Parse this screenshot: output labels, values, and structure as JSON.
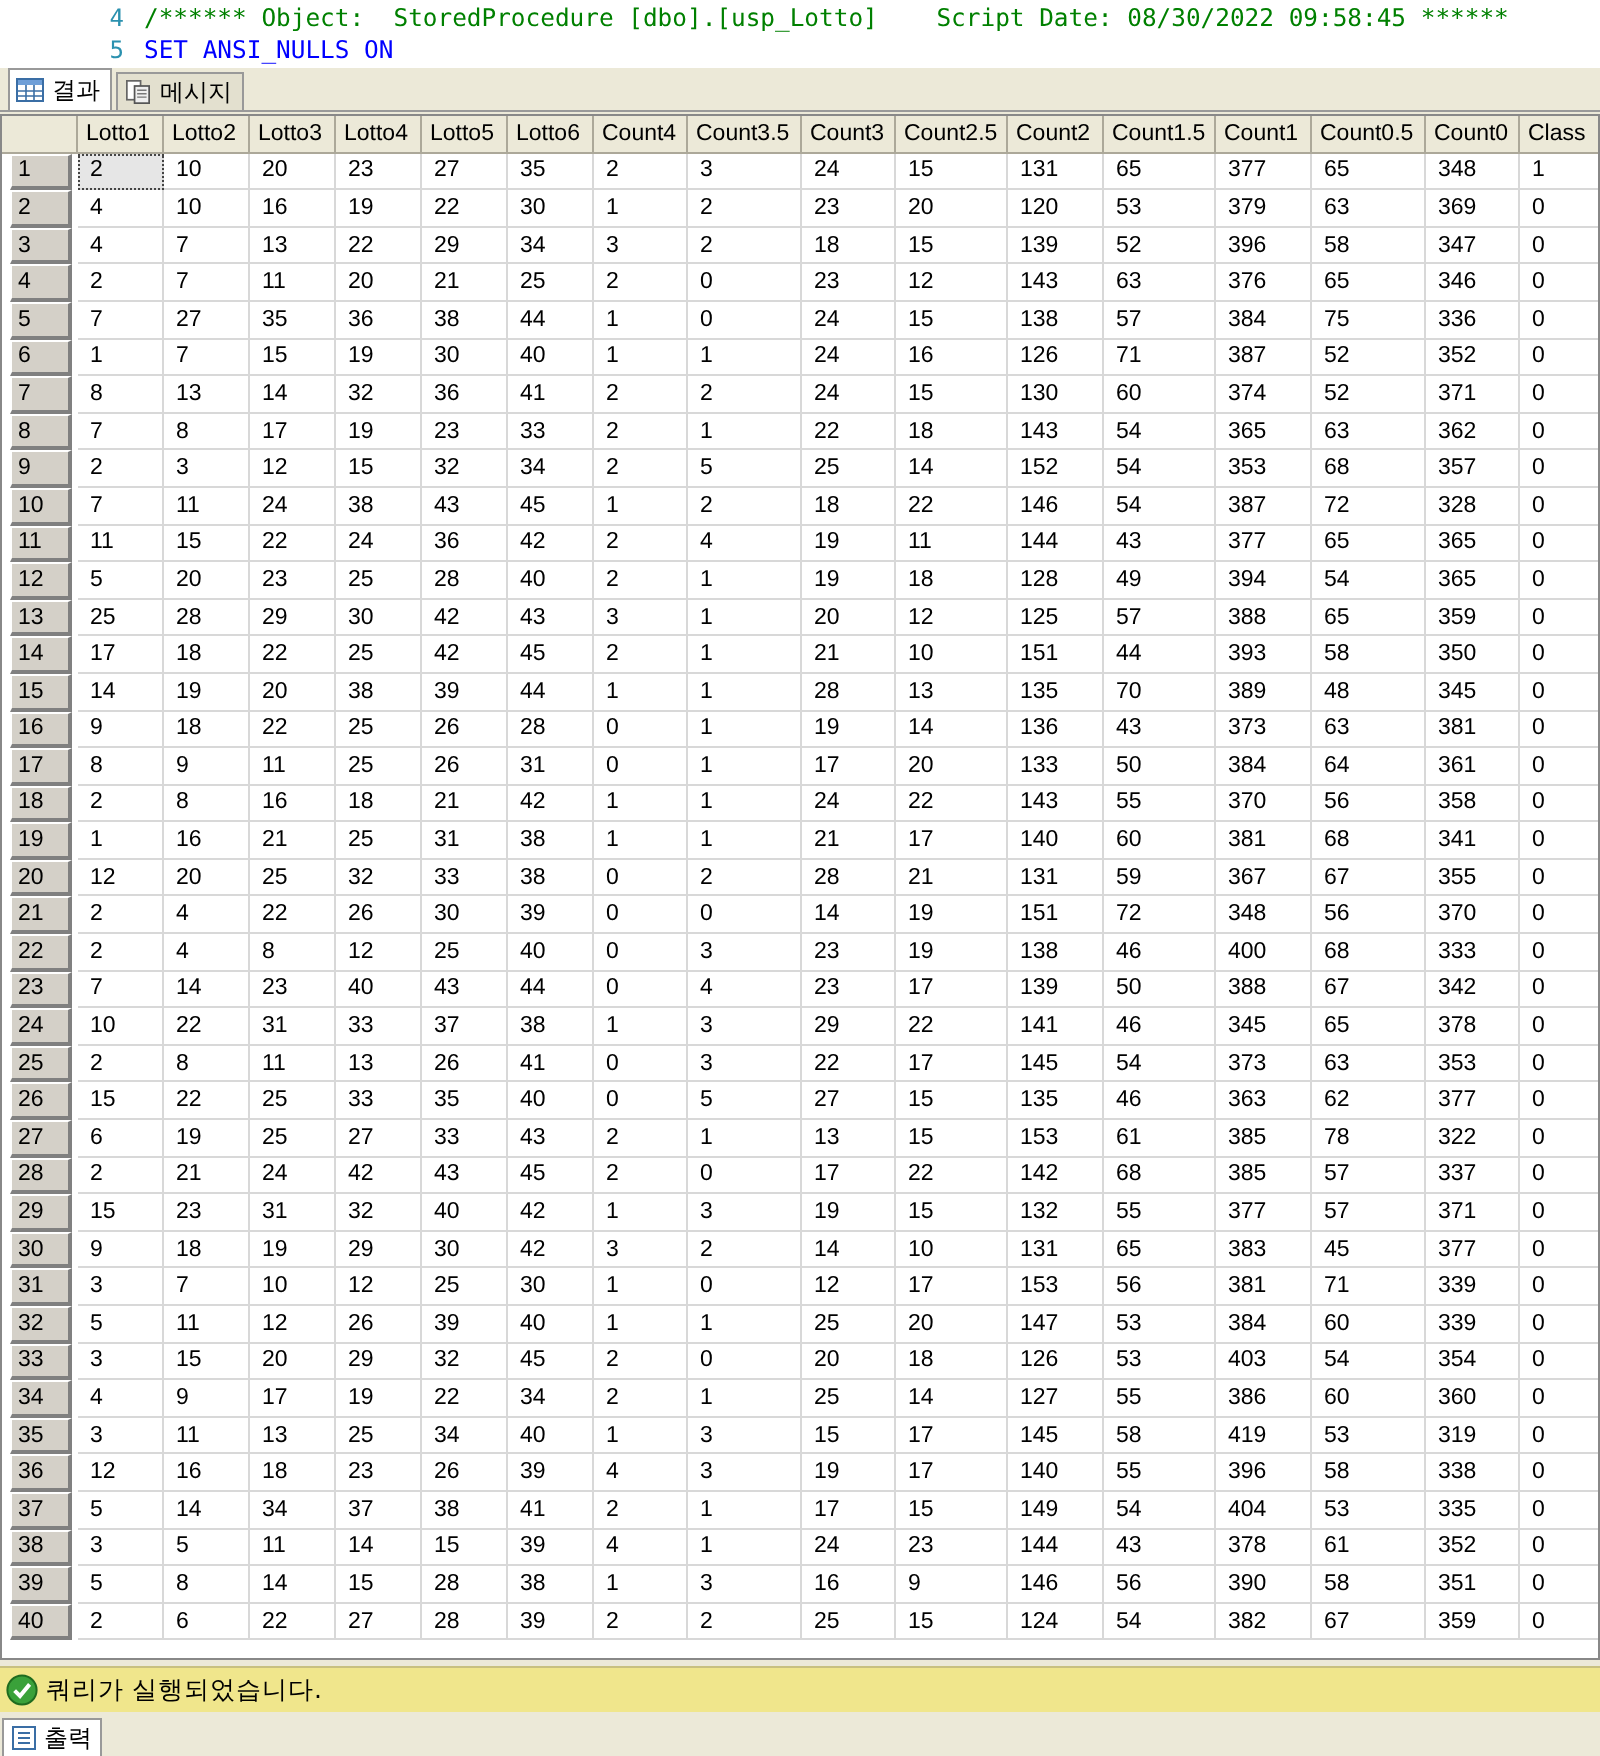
{
  "editor": {
    "lines": [
      {
        "number": "4",
        "kind": "comment",
        "text": "/****** Object:  StoredProcedure [dbo].[usp_Lotto]    Script Date: 08/30/2022 09:58:45 ******"
      },
      {
        "number": "5",
        "kind": "keyword",
        "text": "SET ANSI_NULLS ON"
      }
    ]
  },
  "result_tabs": [
    {
      "label": "결과",
      "kind": "grid",
      "selected": true
    },
    {
      "label": "메시지",
      "kind": "messages",
      "selected": false
    }
  ],
  "table": {
    "columns": [
      "Lotto1",
      "Lotto2",
      "Lotto3",
      "Lotto4",
      "Lotto5",
      "Lotto6",
      "Count4",
      "Count3.5",
      "Count3",
      "Count2.5",
      "Count2",
      "Count1.5",
      "Count1",
      "Count0.5",
      "Count0",
      "Class"
    ],
    "rows": [
      {
        "number": "1",
        "selected": true,
        "cells": [
          "2",
          "10",
          "20",
          "23",
          "27",
          "35",
          "2",
          "3",
          "24",
          "15",
          "131",
          "65",
          "377",
          "65",
          "348",
          "1"
        ]
      },
      {
        "number": "2",
        "selected": false,
        "cells": [
          "4",
          "10",
          "16",
          "19",
          "22",
          "30",
          "1",
          "2",
          "23",
          "20",
          "120",
          "53",
          "379",
          "63",
          "369",
          "0"
        ]
      },
      {
        "number": "3",
        "selected": false,
        "cells": [
          "4",
          "7",
          "13",
          "22",
          "29",
          "34",
          "3",
          "2",
          "18",
          "15",
          "139",
          "52",
          "396",
          "58",
          "347",
          "0"
        ]
      },
      {
        "number": "4",
        "selected": false,
        "cells": [
          "2",
          "7",
          "11",
          "20",
          "21",
          "25",
          "2",
          "0",
          "23",
          "12",
          "143",
          "63",
          "376",
          "65",
          "346",
          "0"
        ]
      },
      {
        "number": "5",
        "selected": false,
        "cells": [
          "7",
          "27",
          "35",
          "36",
          "38",
          "44",
          "1",
          "0",
          "24",
          "15",
          "138",
          "57",
          "384",
          "75",
          "336",
          "0"
        ]
      },
      {
        "number": "6",
        "selected": false,
        "cells": [
          "1",
          "7",
          "15",
          "19",
          "30",
          "40",
          "1",
          "1",
          "24",
          "16",
          "126",
          "71",
          "387",
          "52",
          "352",
          "0"
        ]
      },
      {
        "number": "7",
        "selected": false,
        "cells": [
          "8",
          "13",
          "14",
          "32",
          "36",
          "41",
          "2",
          "2",
          "24",
          "15",
          "130",
          "60",
          "374",
          "52",
          "371",
          "0"
        ]
      },
      {
        "number": "8",
        "selected": false,
        "cells": [
          "7",
          "8",
          "17",
          "19",
          "23",
          "33",
          "2",
          "1",
          "22",
          "18",
          "143",
          "54",
          "365",
          "63",
          "362",
          "0"
        ]
      },
      {
        "number": "9",
        "selected": false,
        "cells": [
          "2",
          "3",
          "12",
          "15",
          "32",
          "34",
          "2",
          "5",
          "25",
          "14",
          "152",
          "54",
          "353",
          "68",
          "357",
          "0"
        ]
      },
      {
        "number": "10",
        "selected": false,
        "cells": [
          "7",
          "11",
          "24",
          "38",
          "43",
          "45",
          "1",
          "2",
          "18",
          "22",
          "146",
          "54",
          "387",
          "72",
          "328",
          "0"
        ]
      },
      {
        "number": "11",
        "selected": false,
        "cells": [
          "11",
          "15",
          "22",
          "24",
          "36",
          "42",
          "2",
          "4",
          "19",
          "11",
          "144",
          "43",
          "377",
          "65",
          "365",
          "0"
        ]
      },
      {
        "number": "12",
        "selected": false,
        "cells": [
          "5",
          "20",
          "23",
          "25",
          "28",
          "40",
          "2",
          "1",
          "19",
          "18",
          "128",
          "49",
          "394",
          "54",
          "365",
          "0"
        ]
      },
      {
        "number": "13",
        "selected": false,
        "cells": [
          "25",
          "28",
          "29",
          "30",
          "42",
          "43",
          "3",
          "1",
          "20",
          "12",
          "125",
          "57",
          "388",
          "65",
          "359",
          "0"
        ]
      },
      {
        "number": "14",
        "selected": false,
        "cells": [
          "17",
          "18",
          "22",
          "25",
          "42",
          "45",
          "2",
          "1",
          "21",
          "10",
          "151",
          "44",
          "393",
          "58",
          "350",
          "0"
        ]
      },
      {
        "number": "15",
        "selected": false,
        "cells": [
          "14",
          "19",
          "20",
          "38",
          "39",
          "44",
          "1",
          "1",
          "28",
          "13",
          "135",
          "70",
          "389",
          "48",
          "345",
          "0"
        ]
      },
      {
        "number": "16",
        "selected": false,
        "cells": [
          "9",
          "18",
          "22",
          "25",
          "26",
          "28",
          "0",
          "1",
          "19",
          "14",
          "136",
          "43",
          "373",
          "63",
          "381",
          "0"
        ]
      },
      {
        "number": "17",
        "selected": false,
        "cells": [
          "8",
          "9",
          "11",
          "25",
          "26",
          "31",
          "0",
          "1",
          "17",
          "20",
          "133",
          "50",
          "384",
          "64",
          "361",
          "0"
        ]
      },
      {
        "number": "18",
        "selected": false,
        "cells": [
          "2",
          "8",
          "16",
          "18",
          "21",
          "42",
          "1",
          "1",
          "24",
          "22",
          "143",
          "55",
          "370",
          "56",
          "358",
          "0"
        ]
      },
      {
        "number": "19",
        "selected": false,
        "cells": [
          "1",
          "16",
          "21",
          "25",
          "31",
          "38",
          "1",
          "1",
          "21",
          "17",
          "140",
          "60",
          "381",
          "68",
          "341",
          "0"
        ]
      },
      {
        "number": "20",
        "selected": false,
        "cells": [
          "12",
          "20",
          "25",
          "32",
          "33",
          "38",
          "0",
          "2",
          "28",
          "21",
          "131",
          "59",
          "367",
          "67",
          "355",
          "0"
        ]
      },
      {
        "number": "21",
        "selected": false,
        "cells": [
          "2",
          "4",
          "22",
          "26",
          "30",
          "39",
          "0",
          "0",
          "14",
          "19",
          "151",
          "72",
          "348",
          "56",
          "370",
          "0"
        ]
      },
      {
        "number": "22",
        "selected": false,
        "cells": [
          "2",
          "4",
          "8",
          "12",
          "25",
          "40",
          "0",
          "3",
          "23",
          "19",
          "138",
          "46",
          "400",
          "68",
          "333",
          "0"
        ]
      },
      {
        "number": "23",
        "selected": false,
        "cells": [
          "7",
          "14",
          "23",
          "40",
          "43",
          "44",
          "0",
          "4",
          "23",
          "17",
          "139",
          "50",
          "388",
          "67",
          "342",
          "0"
        ]
      },
      {
        "number": "24",
        "selected": false,
        "cells": [
          "10",
          "22",
          "31",
          "33",
          "37",
          "38",
          "1",
          "3",
          "29",
          "22",
          "141",
          "46",
          "345",
          "65",
          "378",
          "0"
        ]
      },
      {
        "number": "25",
        "selected": false,
        "cells": [
          "2",
          "8",
          "11",
          "13",
          "26",
          "41",
          "0",
          "3",
          "22",
          "17",
          "145",
          "54",
          "373",
          "63",
          "353",
          "0"
        ]
      },
      {
        "number": "26",
        "selected": false,
        "cells": [
          "15",
          "22",
          "25",
          "33",
          "35",
          "40",
          "0",
          "5",
          "27",
          "15",
          "135",
          "46",
          "363",
          "62",
          "377",
          "0"
        ]
      },
      {
        "number": "27",
        "selected": false,
        "cells": [
          "6",
          "19",
          "25",
          "27",
          "33",
          "43",
          "2",
          "1",
          "13",
          "15",
          "153",
          "61",
          "385",
          "78",
          "322",
          "0"
        ]
      },
      {
        "number": "28",
        "selected": false,
        "cells": [
          "2",
          "21",
          "24",
          "42",
          "43",
          "45",
          "2",
          "0",
          "17",
          "22",
          "142",
          "68",
          "385",
          "57",
          "337",
          "0"
        ]
      },
      {
        "number": "29",
        "selected": false,
        "cells": [
          "15",
          "23",
          "31",
          "32",
          "40",
          "42",
          "1",
          "3",
          "19",
          "15",
          "132",
          "55",
          "377",
          "57",
          "371",
          "0"
        ]
      },
      {
        "number": "30",
        "selected": false,
        "cells": [
          "9",
          "18",
          "19",
          "29",
          "30",
          "42",
          "3",
          "2",
          "14",
          "10",
          "131",
          "65",
          "383",
          "45",
          "377",
          "0"
        ]
      },
      {
        "number": "31",
        "selected": false,
        "cells": [
          "3",
          "7",
          "10",
          "12",
          "25",
          "30",
          "1",
          "0",
          "12",
          "17",
          "153",
          "56",
          "381",
          "71",
          "339",
          "0"
        ]
      },
      {
        "number": "32",
        "selected": false,
        "cells": [
          "5",
          "11",
          "12",
          "26",
          "39",
          "40",
          "1",
          "1",
          "25",
          "20",
          "147",
          "53",
          "384",
          "60",
          "339",
          "0"
        ]
      },
      {
        "number": "33",
        "selected": false,
        "cells": [
          "3",
          "15",
          "20",
          "29",
          "32",
          "45",
          "2",
          "0",
          "20",
          "18",
          "126",
          "53",
          "403",
          "54",
          "354",
          "0"
        ]
      },
      {
        "number": "34",
        "selected": false,
        "cells": [
          "4",
          "9",
          "17",
          "19",
          "22",
          "34",
          "2",
          "1",
          "25",
          "14",
          "127",
          "55",
          "386",
          "60",
          "360",
          "0"
        ]
      },
      {
        "number": "35",
        "selected": false,
        "cells": [
          "3",
          "11",
          "13",
          "25",
          "34",
          "40",
          "1",
          "3",
          "15",
          "17",
          "145",
          "58",
          "419",
          "53",
          "319",
          "0"
        ]
      },
      {
        "number": "36",
        "selected": false,
        "cells": [
          "12",
          "16",
          "18",
          "23",
          "26",
          "39",
          "4",
          "3",
          "19",
          "17",
          "140",
          "55",
          "396",
          "58",
          "338",
          "0"
        ]
      },
      {
        "number": "37",
        "selected": false,
        "cells": [
          "5",
          "14",
          "34",
          "37",
          "38",
          "41",
          "2",
          "1",
          "17",
          "15",
          "149",
          "54",
          "404",
          "53",
          "335",
          "0"
        ]
      },
      {
        "number": "38",
        "selected": false,
        "cells": [
          "3",
          "5",
          "11",
          "14",
          "15",
          "39",
          "4",
          "1",
          "24",
          "23",
          "144",
          "43",
          "378",
          "61",
          "352",
          "0"
        ]
      },
      {
        "number": "39",
        "selected": false,
        "cells": [
          "5",
          "8",
          "14",
          "15",
          "28",
          "38",
          "1",
          "3",
          "16",
          "9",
          "146",
          "56",
          "390",
          "58",
          "351",
          "0"
        ]
      },
      {
        "number": "40",
        "selected": false,
        "cells": [
          "2",
          "6",
          "22",
          "27",
          "28",
          "39",
          "2",
          "2",
          "25",
          "15",
          "124",
          "54",
          "382",
          "67",
          "359",
          "0"
        ]
      }
    ]
  },
  "status_bar": {
    "message": "쿼리가 실행되었습니다.",
    "succeeded": true
  },
  "bottom_tabs": [
    {
      "label": "출력",
      "selected": true
    }
  ]
}
